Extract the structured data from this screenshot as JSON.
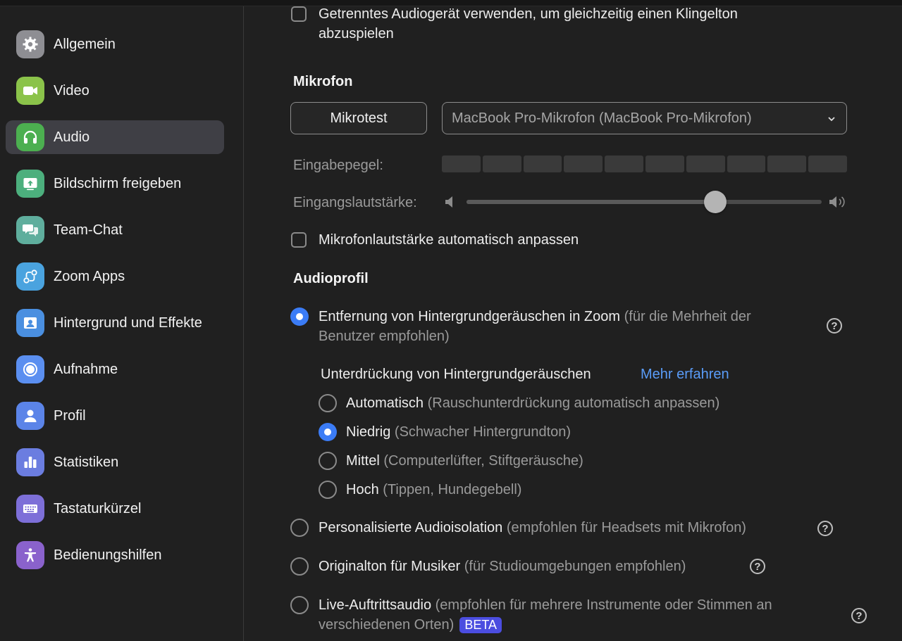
{
  "sidebar": {
    "items": [
      {
        "label": "Allgemein",
        "icon": "gear-icon",
        "color": "#8e8e93"
      },
      {
        "label": "Video",
        "icon": "video-camera-icon",
        "color": "#8bc34a"
      },
      {
        "label": "Audio",
        "icon": "headphones-icon",
        "color": "#4caf50",
        "active": true
      },
      {
        "label": "Bildschirm freigeben",
        "icon": "share-screen-icon",
        "color": "#4caf7d"
      },
      {
        "label": "Team-Chat",
        "icon": "chat-bubbles-icon",
        "color": "#5fae9d"
      },
      {
        "label": "Zoom Apps",
        "icon": "apps-icon",
        "color": "#4aa3df"
      },
      {
        "label": "Hintergrund und Effekte",
        "icon": "person-background-icon",
        "color": "#4a8fe0"
      },
      {
        "label": "Aufnahme",
        "icon": "record-icon",
        "color": "#5b8ff0"
      },
      {
        "label": "Profil",
        "icon": "person-icon",
        "color": "#5b84e8"
      },
      {
        "label": "Statistiken",
        "icon": "bar-chart-icon",
        "color": "#6b7de0"
      },
      {
        "label": "Tastaturkürzel",
        "icon": "keyboard-icon",
        "color": "#7d6fd8"
      },
      {
        "label": "Bedienungshilfen",
        "icon": "accessibility-icon",
        "color": "#8a62cc"
      }
    ]
  },
  "top_option": {
    "line1": "Getrenntes Audiogerät verwenden, um gleichzeitig einen Klingelton",
    "line2": "abzuspielen"
  },
  "mikrofon": {
    "title": "Mikrofon",
    "test_button": "Mikrotest",
    "device": "MacBook Pro-Mikrofon (MacBook Pro-Mikrofon)",
    "input_level_label": "Eingabepegel:",
    "input_level_segments": 10,
    "input_level_fraction": 0.0,
    "volume_label": "Eingangslautstärke:",
    "volume_fraction": 0.7,
    "auto_adjust_label": "Mikrofonlautstärke automatisch anpassen"
  },
  "audioprofil": {
    "title": "Audioprofil",
    "opt1_main": "Entfernung von Hintergrundgeräuschen in Zoom",
    "opt1_hint_a": "(für die Mehrheit der",
    "opt1_hint_b": "Benutzer empfohlen)",
    "suppression_label": "Unterdrückung von Hintergrundgeräuschen",
    "learn_more": "Mehr erfahren",
    "levels": [
      {
        "main": "Automatisch",
        "hint": "(Rauschunterdrückung automatisch anpassen)",
        "selected": false
      },
      {
        "main": "Niedrig",
        "hint": "(Schwacher Hintergrundton)",
        "selected": true
      },
      {
        "main": "Mittel",
        "hint": "(Computerlüfter, Stiftgeräusche)",
        "selected": false
      },
      {
        "main": "Hoch",
        "hint": "(Tippen, Hundegebell)",
        "selected": false
      }
    ],
    "opt2_main": "Personalisierte Audioisolation",
    "opt2_hint": "(empfohlen für Headsets mit Mikrofon)",
    "opt3_main": "Originalton für Musiker",
    "opt3_hint": "(für Studioumgebungen empfohlen)",
    "opt4_main": "Live-Auftrittsaudio",
    "opt4_hint_a": "(empfohlen für mehrere Instrumente oder Stimmen an",
    "opt4_hint_b": "verschiedenen Orten)",
    "beta": "BETA",
    "help_glyph": "?"
  },
  "colors": {
    "accent": "#3b7cf6",
    "link": "#5a9cf8",
    "beta": "#4b4de0"
  }
}
